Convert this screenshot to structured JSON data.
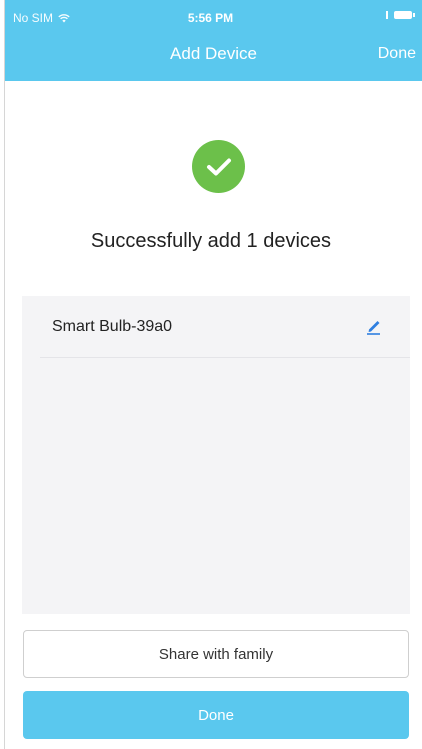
{
  "status_bar": {
    "carrier": "No SIM",
    "time": "5:56 PM"
  },
  "nav": {
    "title": "Add Device",
    "done_label": "Done"
  },
  "success": {
    "message": "Successfully add 1 devices"
  },
  "devices": [
    {
      "name": "Smart Bulb-39a0"
    }
  ],
  "buttons": {
    "share_label": "Share with family",
    "done_label": "Done"
  },
  "colors": {
    "header_bg": "#5ac8ee",
    "success_green": "#6cc04a",
    "edit_blue": "#2f7fe0",
    "panel_bg": "#f4f4f6"
  },
  "icons": {
    "status_wifi": "wifi-icon",
    "status_battery": "battery-icon",
    "success": "checkmark-circle-icon",
    "edit": "pencil-edit-icon"
  }
}
